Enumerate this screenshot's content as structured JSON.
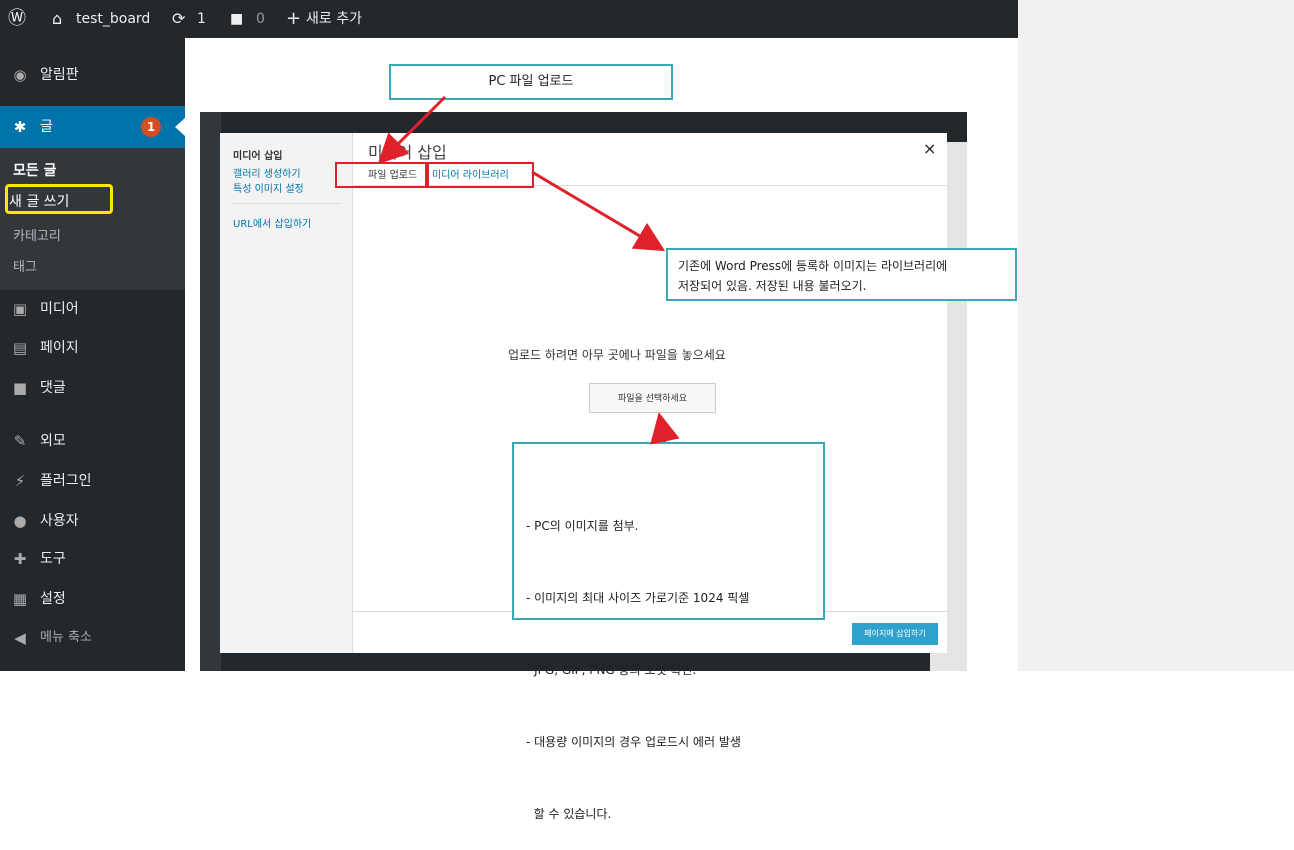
{
  "adminbar": {
    "site_name": "test_board",
    "updates_count": "1",
    "comments_count": "0",
    "new_label": "새로 추가"
  },
  "sidebar": {
    "dashboard": "알림판",
    "posts": "글",
    "posts_badge": "1",
    "submenu": [
      "모든 글",
      "새 글 쓰기",
      "카테고리",
      "태그"
    ],
    "media": "미디어",
    "pages": "페이지",
    "comments": "댓글",
    "appearance": "외모",
    "plugins": "플러그인",
    "users": "사용자",
    "tools": "도구",
    "settings": "설정",
    "collapse": "메뉴 축소"
  },
  "inset": {
    "modal": {
      "left_menu": {
        "insert_media": "미디어 삽입",
        "create_gallery": "갤러리 생성하기",
        "featured_image": "특성 이미지 설정",
        "insert_from_url": "URL에서 삽입하기"
      },
      "title": "미디어 삽입",
      "tabs": {
        "upload": "파일 업로드",
        "library": "미디어 라이브러리"
      },
      "drop_text": "업로드 하려면 아무 곳에나 파일을 놓으세요",
      "select_button": "파일을 선택하세요",
      "insert_button": "페이지에 삽입하기",
      "close": "×"
    }
  },
  "annotations": {
    "pc_upload": "PC 파일 업로드",
    "library_note_line1": "기존에 Word Press에 등록하 이미지는 라이브러리에",
    "library_note_line2": "저장되어 있음. 저장된 내용 불러오기.",
    "bullets": [
      "- PC의 이미지를 첨부.",
      "- 이미지의 최대 사이즈 가로기준 1024 픽셀",
      "- JPG, GIF, PNG 등의 포맷 확인.",
      "- 대용량 이미지의 경우 업로드시 에러 발생",
      "  할 수 있습니다."
    ]
  },
  "colors": {
    "adminbar": "#23282d",
    "accent": "#0073aa",
    "highlight": "#ffe600",
    "arrow": "#e0202a",
    "callout": "#3aa8b8"
  }
}
